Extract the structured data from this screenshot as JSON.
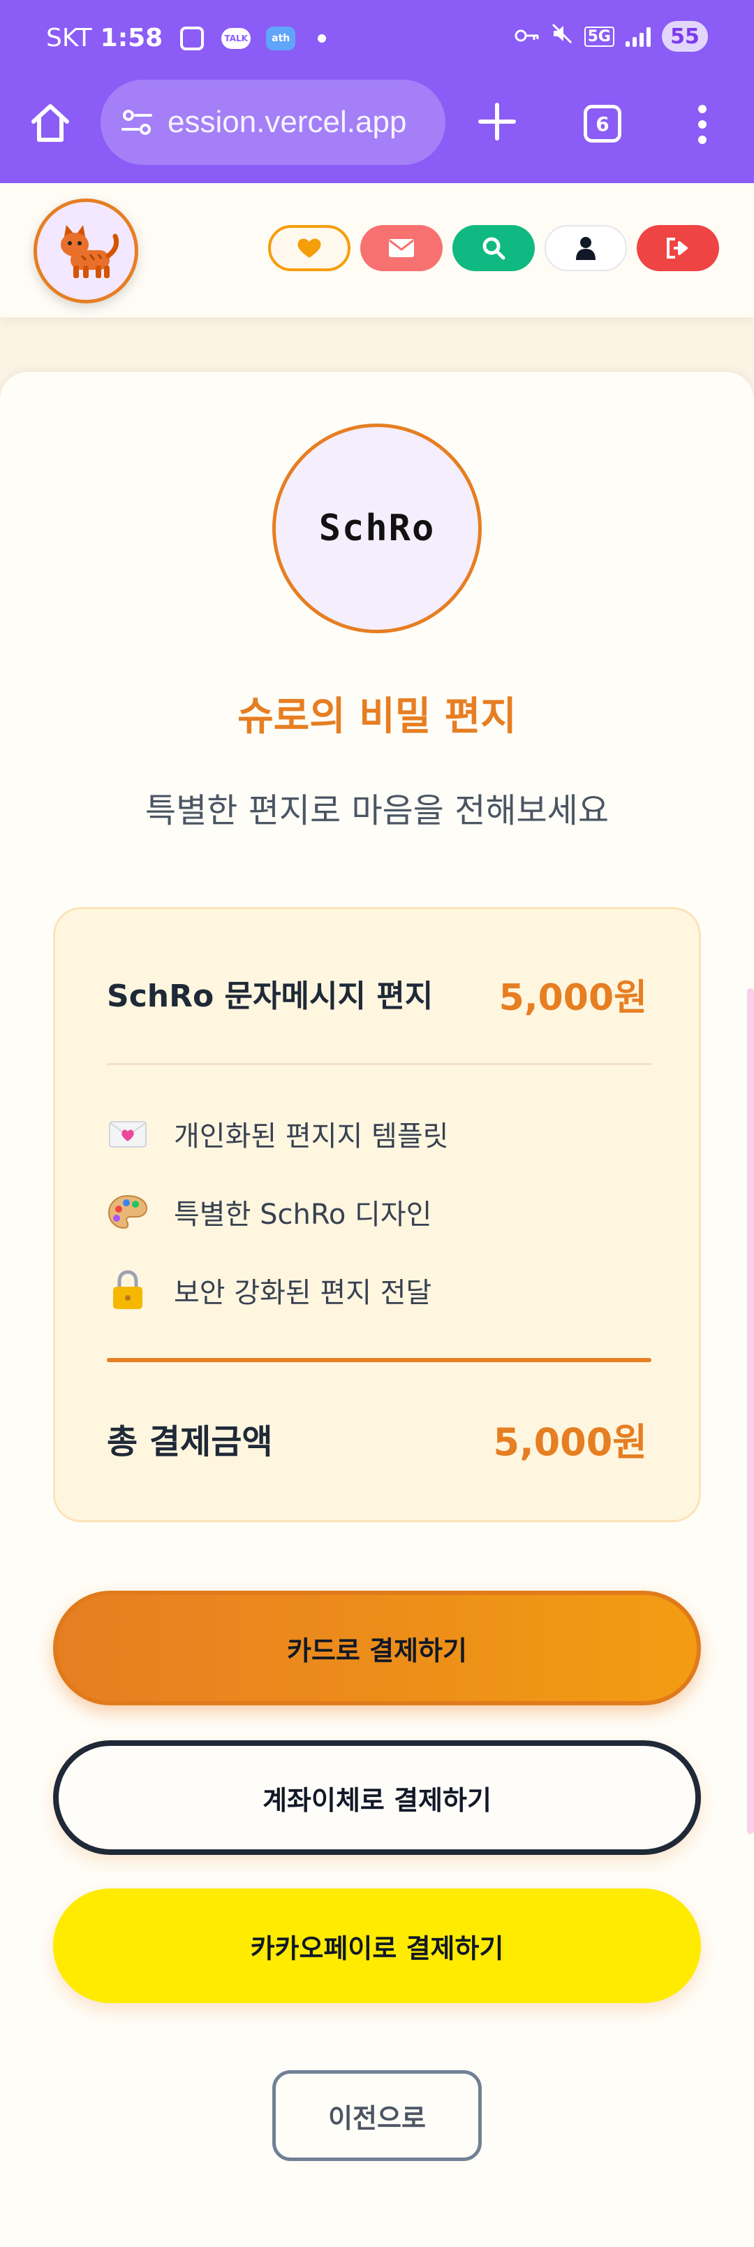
{
  "status_bar": {
    "carrier": "SKT",
    "time": "1:58",
    "talk_badge": "TALK",
    "ath_badge": "ath",
    "network": "5G",
    "battery": "55"
  },
  "browser": {
    "url": "ession.vercel.app",
    "tab_count": "6"
  },
  "header": {
    "avatar_icon": "cat-icon",
    "buttons": [
      "heart-icon",
      "mail-icon",
      "search-icon",
      "user-icon",
      "logout-icon"
    ]
  },
  "hero": {
    "logo_text": "SchRo",
    "title": "슈로의 비밀 편지",
    "subtitle": "특별한 편지로 마음을 전해보세요"
  },
  "order": {
    "product_name": "SchRo 문자메시지 편지",
    "product_price": "5,000원",
    "features": [
      {
        "icon": "love-letter-icon",
        "text": "개인화된 편지지 템플릿"
      },
      {
        "icon": "palette-icon",
        "text": "특별한 SchRo 디자인"
      },
      {
        "icon": "lock-icon",
        "text": "보안 강화된 편지 전달"
      }
    ],
    "total_label": "총 결제금액",
    "total_price": "5,000원"
  },
  "payment": {
    "card_label": "카드로 결제하기",
    "bank_label": "계좌이체로 결제하기",
    "kakao_label": "카카오페이로 결제하기",
    "back_label": "이전으로"
  },
  "colors": {
    "browser_bar": "#8b5cf6",
    "accent": "#e67e22",
    "kakao_yellow": "#ffeb00",
    "page_bg": "#fbf3e3"
  }
}
